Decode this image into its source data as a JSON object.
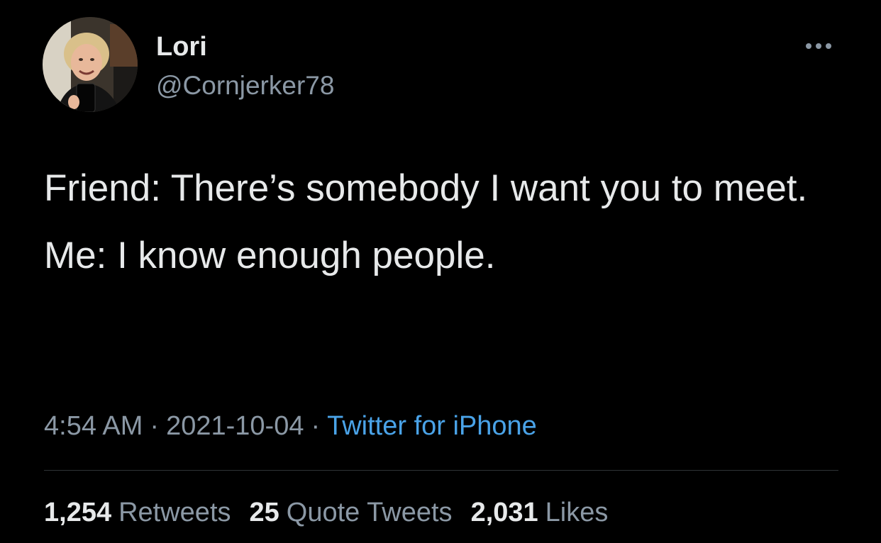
{
  "author": {
    "name": "Lori",
    "handle": "@Cornjerker78",
    "avatar_icon": "profile-photo"
  },
  "menu_icon": "more-horizontal-icon",
  "tweet": {
    "lines": [
      "Friend: There’s somebody I want you to meet.",
      "Me: I know enough people."
    ]
  },
  "meta": {
    "time": "4:54 AM",
    "separator": "·",
    "date": "2021-10-04",
    "source": "Twitter for iPhone"
  },
  "stats": {
    "retweets_count": "1,254",
    "retweets_label": "Retweets",
    "quotes_count": "25",
    "quotes_label": "Quote Tweets",
    "likes_count": "2,031",
    "likes_label": "Likes"
  },
  "colors": {
    "background": "#000000",
    "primary_text": "#e7e9ea",
    "secondary_text": "#8b98a5",
    "link": "#4aa3e8",
    "divider": "#2f3336"
  }
}
